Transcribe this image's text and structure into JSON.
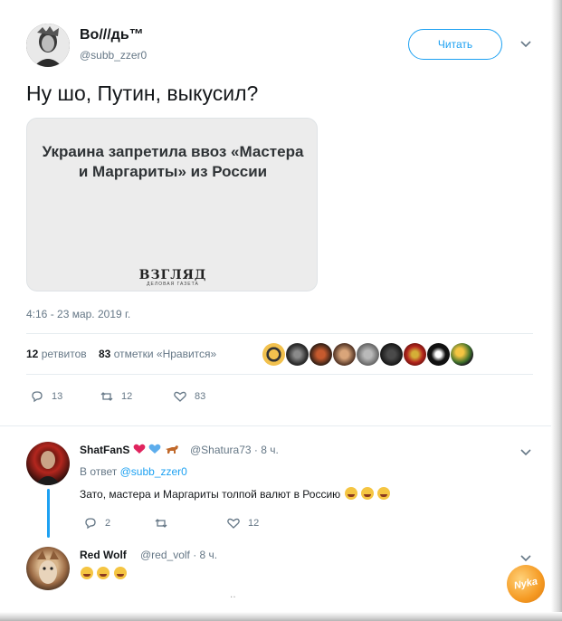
{
  "tweet": {
    "author_name": "Во///дь™",
    "author_handle": "@subb_zzer0",
    "follow_label": "Читать",
    "text": "Ну шо, Путин, выкусил?",
    "card": {
      "title": "Украина запретила ввоз «Мастера и Маргариты» из России",
      "source_logo": "ВЗГЛЯД",
      "source_tagline": "ДЕЛОВАЯ ГАЗЕТА"
    },
    "timestamp": "4:16 - 23 мар. 2019 г.",
    "retweets_count": "12",
    "retweets_label": "ретвитов",
    "likes_count": "83",
    "likes_label": "отметки «Нравится»",
    "actions": {
      "reply": "13",
      "retweet": "12",
      "like": "83"
    }
  },
  "replies": [
    {
      "name": "ShatFanS",
      "handle": "@Shatura73",
      "time": "· 8 ч.",
      "reply_to_prefix": "В ответ",
      "reply_to_handle": "@subb_zzer0",
      "text": "Зато, мастера и Маргариты толпой валют в Россию",
      "actions": {
        "reply": "2",
        "like": "12"
      }
    },
    {
      "name": "Red Wolf",
      "handle": "@red_volf",
      "time": "· 8 ч."
    }
  ],
  "watermark": "Nyka",
  "colors": {
    "accent": "#1da1f2",
    "muted": "#657786",
    "text": "#14171a",
    "heart": "#e0245e"
  }
}
